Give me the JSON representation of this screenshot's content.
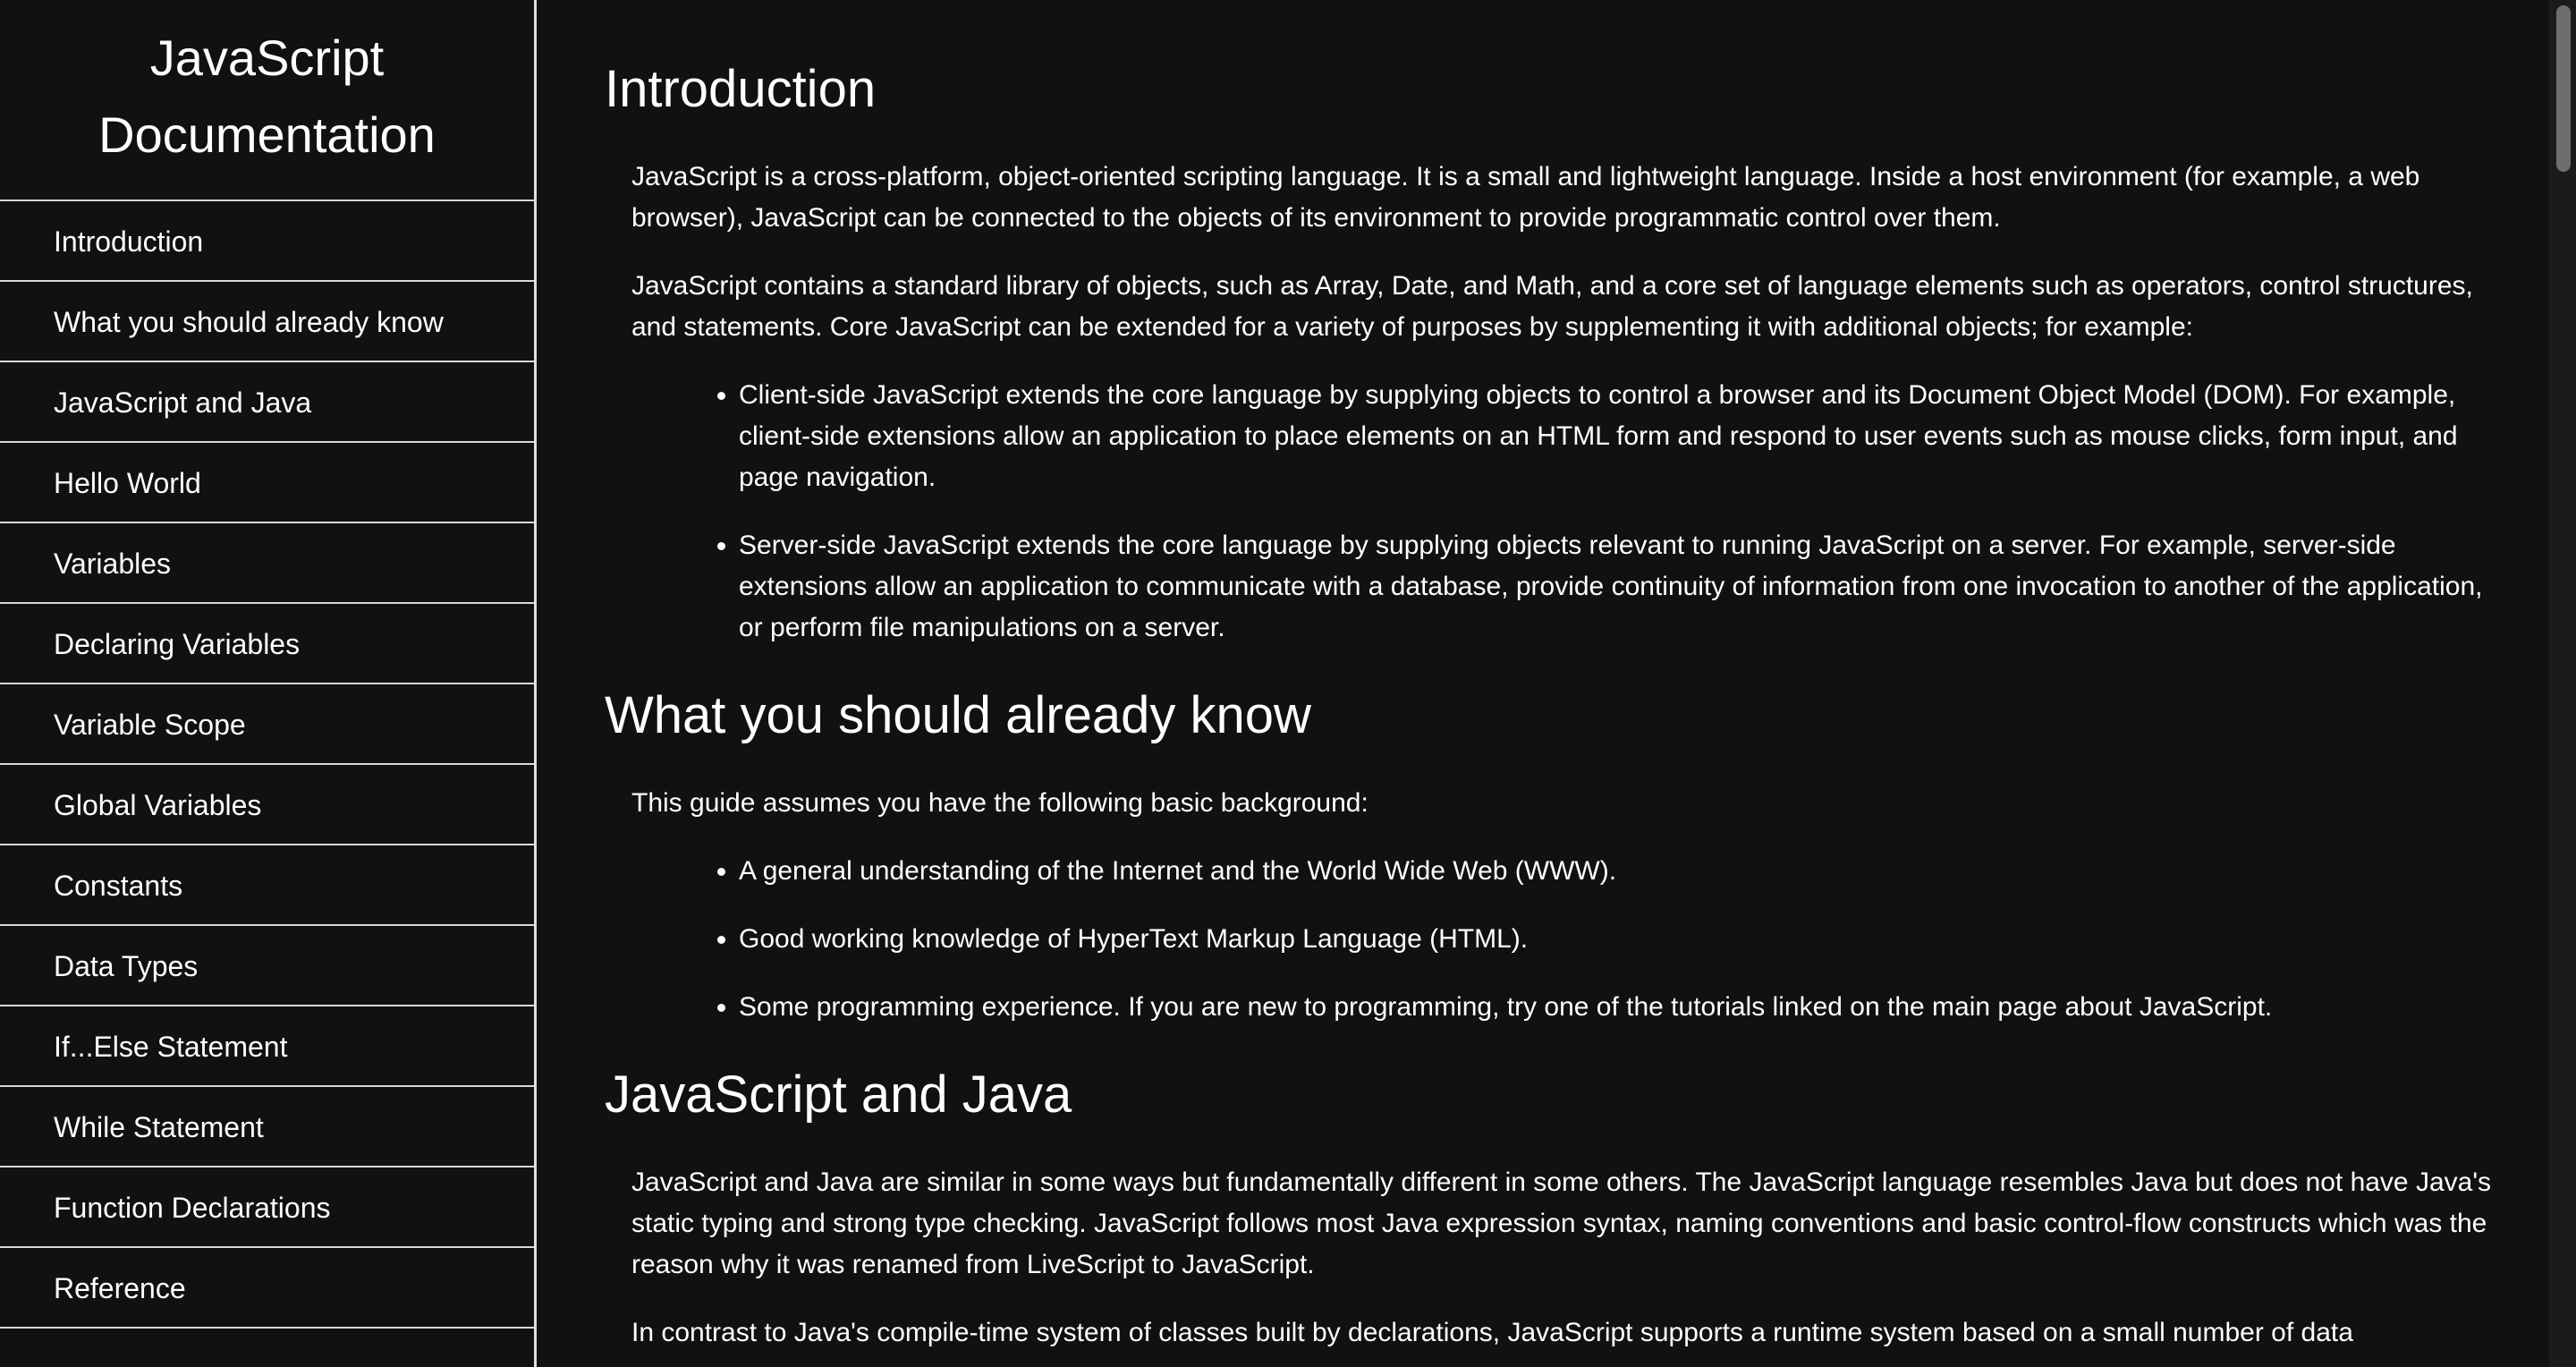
{
  "navbar": {
    "title": "JavaScript Documentation",
    "items": [
      "Introduction",
      "What you should already know",
      "JavaScript and Java",
      "Hello World",
      "Variables",
      "Declaring Variables",
      "Variable Scope",
      "Global Variables",
      "Constants",
      "Data Types",
      "If...Else Statement",
      "While Statement",
      "Function Declarations",
      "Reference"
    ]
  },
  "sections": {
    "introduction": {
      "title": "Introduction",
      "paragraphs": [
        "JavaScript is a cross-platform, object-oriented scripting language. It is a small and lightweight language. Inside a host environment (for example, a web browser), JavaScript can be connected to the objects of its environment to provide programmatic control over them.",
        "JavaScript contains a standard library of objects, such as Array, Date, and Math, and a core set of language elements such as operators, control structures, and statements. Core JavaScript can be extended for a variety of purposes by supplementing it with additional objects; for example:"
      ],
      "list": [
        "Client-side JavaScript extends the core language by supplying objects to control a browser and its Document Object Model (DOM). For example, client-side extensions allow an application to place elements on an HTML form and respond to user events such as mouse clicks, form input, and page navigation.",
        "Server-side JavaScript extends the core language by supplying objects relevant to running JavaScript on a server. For example, server-side extensions allow an application to communicate with a database, provide continuity of information from one invocation to another of the application, or perform file manipulations on a server."
      ]
    },
    "already_know": {
      "title": "What you should already know",
      "paragraphs": [
        "This guide assumes you have the following basic background:"
      ],
      "list": [
        "A general understanding of the Internet and the World Wide Web (WWW).",
        "Good working knowledge of HyperText Markup Language (HTML).",
        "Some programming experience. If you are new to programming, try one of the tutorials linked on the main page about JavaScript."
      ]
    },
    "javascript_java": {
      "title": "JavaScript and Java",
      "paragraphs": [
        "JavaScript and Java are similar in some ways but fundamentally different in some others. The JavaScript language resembles Java but does not have Java's static typing and strong type checking. JavaScript follows most Java expression syntax, naming conventions and basic control-flow constructs which was the reason why it was renamed from LiveScript to JavaScript.",
        "In contrast to Java's compile-time system of classes built by declarations, JavaScript supports a runtime system based on a small number of data"
      ]
    }
  },
  "colors": {
    "background": "#111111",
    "text": "#ffffff",
    "border": "#d8d8d8"
  }
}
